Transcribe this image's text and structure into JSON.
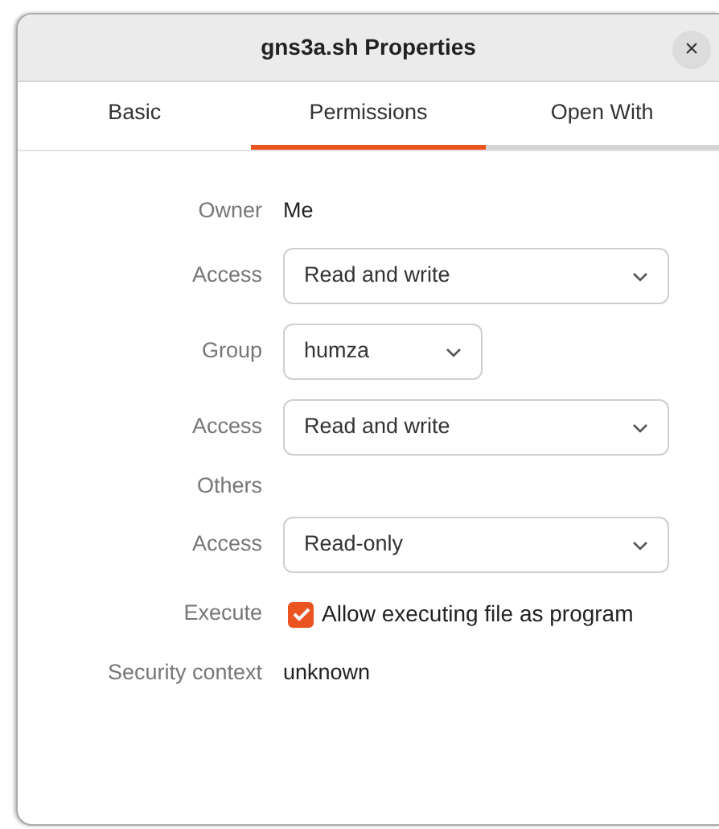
{
  "window": {
    "title": "gns3a.sh Properties",
    "close": "×"
  },
  "tabs": [
    {
      "label": "Basic",
      "selected": false
    },
    {
      "label": "Permissions",
      "selected": true
    },
    {
      "label": "Open With",
      "selected": false
    }
  ],
  "rows": [
    {
      "kind": "text",
      "label": "Owner",
      "value": "Me"
    },
    {
      "kind": "dropdown",
      "label": "Access",
      "value": "Read and write",
      "wide": true
    },
    {
      "kind": "dropdown",
      "label": "Group",
      "value": "humza",
      "wide": false
    },
    {
      "kind": "dropdown",
      "label": "Access",
      "value": "Read and write",
      "wide": true
    },
    {
      "kind": "heading",
      "label": "Others"
    },
    {
      "kind": "dropdown",
      "label": "Access",
      "value": "Read-only",
      "wide": true
    },
    {
      "kind": "checkbox",
      "label": "Execute",
      "value": "Allow executing file as program",
      "checked": true
    },
    {
      "kind": "text",
      "label": "Security context",
      "value": "unknown"
    }
  ]
}
